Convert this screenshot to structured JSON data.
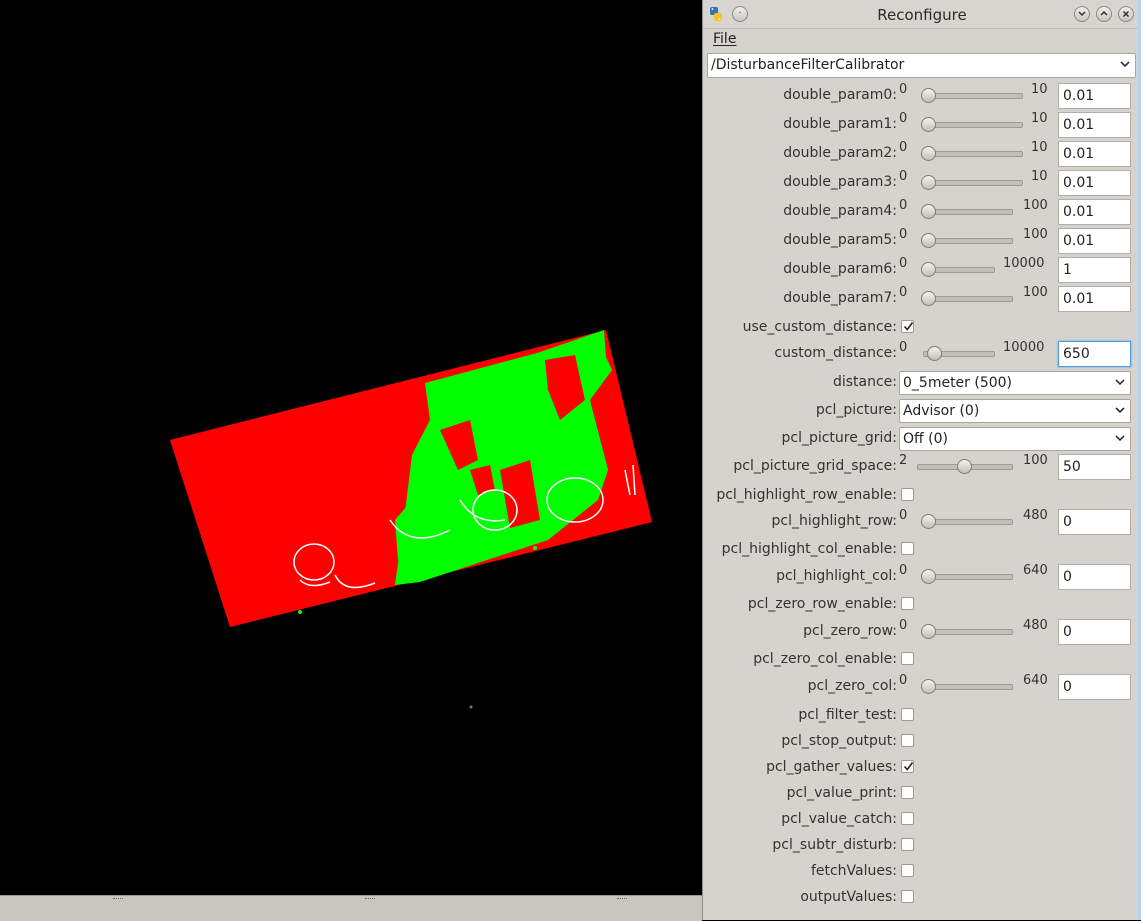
{
  "window": {
    "title": "Reconfigure",
    "menu_file": "File"
  },
  "node_selector": {
    "value": "/DisturbanceFilterCalibrator"
  },
  "params": [
    {
      "label": "double_param0:",
      "type": "slider",
      "min": "0",
      "max": "10",
      "value": "0.01",
      "fraction": 0.001
    },
    {
      "label": "double_param1:",
      "type": "slider",
      "min": "0",
      "max": "10",
      "value": "0.01",
      "fraction": 0.001
    },
    {
      "label": "double_param2:",
      "type": "slider",
      "min": "0",
      "max": "10",
      "value": "0.01",
      "fraction": 0.001
    },
    {
      "label": "double_param3:",
      "type": "slider",
      "min": "0",
      "max": "10",
      "value": "0.01",
      "fraction": 0.001
    },
    {
      "label": "double_param4:",
      "type": "slider",
      "min": "0",
      "max": "100",
      "value": "0.01",
      "fraction": 0.0001
    },
    {
      "label": "double_param5:",
      "type": "slider",
      "min": "0",
      "max": "100",
      "value": "0.01",
      "fraction": 0.0001
    },
    {
      "label": "double_param6:",
      "type": "slider",
      "min": "0",
      "max": "10000",
      "value": "1",
      "fraction": 0.0001
    },
    {
      "label": "double_param7:",
      "type": "slider",
      "min": "0",
      "max": "100",
      "value": "0.01",
      "fraction": 0.0001
    },
    {
      "label": "use_custom_distance:",
      "type": "check",
      "checked": true
    },
    {
      "label": "custom_distance:",
      "type": "slider",
      "min": "0",
      "max": "10000",
      "value": "650",
      "fraction": 0.065,
      "focused": true
    },
    {
      "label": "distance:",
      "type": "combo",
      "value": "0_5meter (500)"
    },
    {
      "label": "pcl_picture:",
      "type": "combo",
      "value": "Advisor (0)"
    },
    {
      "label": "pcl_picture_grid:",
      "type": "combo",
      "value": "Off (0)"
    },
    {
      "label": "pcl_picture_grid_space:",
      "type": "slider",
      "min": "2",
      "max": "100",
      "value": "50",
      "fraction": 0.49
    },
    {
      "label": "pcl_highlight_row_enable:",
      "type": "check",
      "checked": false
    },
    {
      "label": "pcl_highlight_row:",
      "type": "slider",
      "min": "0",
      "max": "480",
      "value": "0",
      "fraction": 0
    },
    {
      "label": "pcl_highlight_col_enable:",
      "type": "check",
      "checked": false
    },
    {
      "label": "pcl_highlight_col:",
      "type": "slider",
      "min": "0",
      "max": "640",
      "value": "0",
      "fraction": 0
    },
    {
      "label": "pcl_zero_row_enable:",
      "type": "check",
      "checked": false
    },
    {
      "label": "pcl_zero_row:",
      "type": "slider",
      "min": "0",
      "max": "480",
      "value": "0",
      "fraction": 0
    },
    {
      "label": "pcl_zero_col_enable:",
      "type": "check",
      "checked": false
    },
    {
      "label": "pcl_zero_col:",
      "type": "slider",
      "min": "0",
      "max": "640",
      "value": "0",
      "fraction": 0
    },
    {
      "label": "pcl_filter_test:",
      "type": "check",
      "checked": false
    },
    {
      "label": "pcl_stop_output:",
      "type": "check",
      "checked": false
    },
    {
      "label": "pcl_gather_values:",
      "type": "check",
      "checked": true
    },
    {
      "label": "pcl_value_print:",
      "type": "check",
      "checked": false
    },
    {
      "label": "pcl_value_catch:",
      "type": "check",
      "checked": false
    },
    {
      "label": "pcl_subtr_disturb:",
      "type": "check",
      "checked": false
    },
    {
      "label": "fetchValues:",
      "type": "check",
      "checked": false
    },
    {
      "label": "outputValues:",
      "type": "check",
      "checked": false
    }
  ],
  "colors": {
    "background": "#000000",
    "cloud_red": "#ff0000",
    "cloud_green": "#00ff00",
    "panel": "#d6d2ce",
    "focus": "#4b9be0"
  }
}
